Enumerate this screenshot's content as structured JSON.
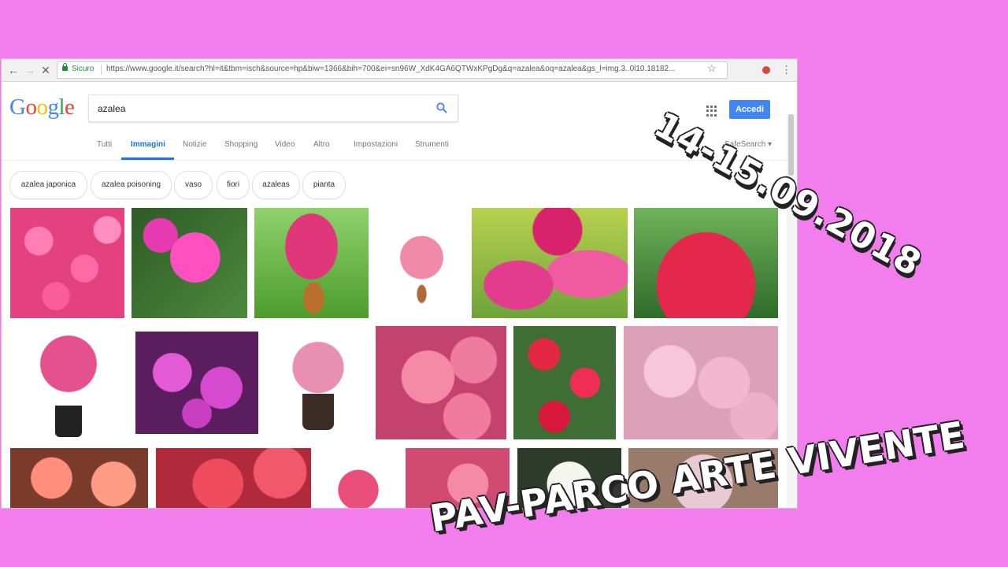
{
  "browser": {
    "secure_label": "Sicuro",
    "url": "https://www.google.it/search?hl=it&tbm=isch&source=hp&biw=1366&bih=700&ei=sn96W_XdK4GA6QTWxKPgDg&q=azalea&oq=azalea&gs_l=img.3..0l10.18182..."
  },
  "google": {
    "logo_letters": [
      "G",
      "o",
      "o",
      "g",
      "l",
      "e"
    ],
    "logo_colors": [
      "#4285f4",
      "#ea4335",
      "#fbbc05",
      "#4285f4",
      "#34a853",
      "#ea4335"
    ],
    "query": "azalea",
    "signin_label": "Accedi",
    "accent": "#1a73e8"
  },
  "tabs": [
    {
      "label": "Tutti",
      "active": false
    },
    {
      "label": "Immagini",
      "active": true
    },
    {
      "label": "Notizie",
      "active": false
    },
    {
      "label": "Shopping",
      "active": false
    },
    {
      "label": "Video",
      "active": false
    },
    {
      "label": "Altro",
      "active": false
    },
    {
      "label": "Impostazioni",
      "active": false
    },
    {
      "label": "Strumenti",
      "active": false
    }
  ],
  "safesearch_label": "SafeSearch ▾",
  "chips": [
    "azalea japonica",
    "azalea poisoning",
    "vaso",
    "fiori",
    "azaleas",
    "pianta"
  ],
  "overlays": {
    "date": "14-15.09.2018",
    "title": "PAV-PARCO ARTE VIVENTE"
  }
}
